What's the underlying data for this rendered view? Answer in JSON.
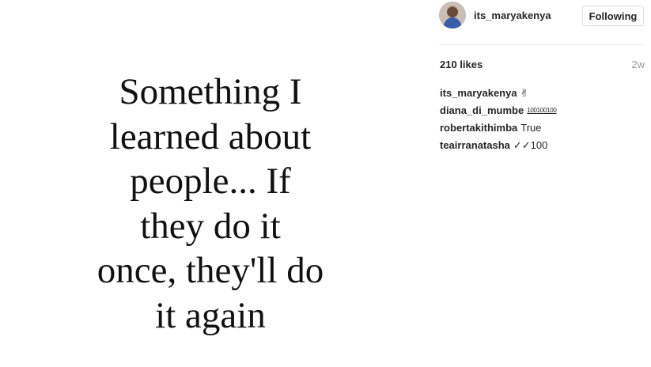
{
  "post": {
    "quote_lines": [
      "Something I",
      "learned about",
      "people... If",
      "they do it",
      "once, they'll do",
      "it again"
    ]
  },
  "header": {
    "username": "its_maryakenya",
    "follow_label": "Following"
  },
  "stats": {
    "likes": "210 likes",
    "time": "2w"
  },
  "comments": [
    {
      "author": "its_maryakenya",
      "text": "✌"
    },
    {
      "author": "diana_di_mumbe",
      "text": "100100100"
    },
    {
      "author": "robertakithimba",
      "text": "True"
    },
    {
      "author": "teairranatasha",
      "text": "✓✓100"
    }
  ]
}
